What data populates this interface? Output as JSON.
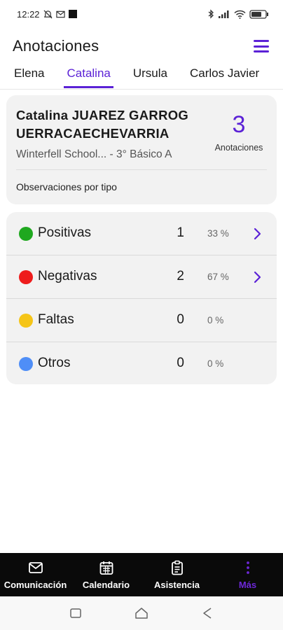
{
  "status_bar": {
    "time": "12:22",
    "icons": [
      "alarm-off-icon",
      "mail-icon",
      "square-icon",
      "bluetooth-icon",
      "signal-icon",
      "wifi-icon",
      "battery-icon"
    ]
  },
  "header": {
    "title": "Anotaciones",
    "menu_icon": "hamburger-menu-icon"
  },
  "tabs": [
    {
      "label": "Elena",
      "active": false
    },
    {
      "label": "Catalina",
      "active": true
    },
    {
      "label": "Ursula",
      "active": false
    },
    {
      "label": "Carlos Javier",
      "active": false
    }
  ],
  "student": {
    "name": "Catalina JUAREZ GARROG UERRACAECHEVARRIA",
    "school": "Winterfell School... - 3° Básico A",
    "count": "3",
    "count_label": "Anotaciones",
    "section_label": "Observaciones por tipo"
  },
  "types": [
    {
      "label": "Positivas",
      "count": "1",
      "percent": "33 %",
      "color": "#1fa81f",
      "has_chevron": true
    },
    {
      "label": "Negativas",
      "count": "2",
      "percent": "67 %",
      "color": "#ee1c1c",
      "has_chevron": true
    },
    {
      "label": "Faltas",
      "count": "0",
      "percent": "0 %",
      "color": "#f5c518",
      "has_chevron": false
    },
    {
      "label": "Otros",
      "count": "0",
      "percent": "0 %",
      "color": "#4f8ef7",
      "has_chevron": false
    }
  ],
  "bottom_nav": [
    {
      "label": "Comunicación",
      "icon": "mail-icon",
      "active": false
    },
    {
      "label": "Calendario",
      "icon": "calendar-icon",
      "active": false
    },
    {
      "label": "Asistencia",
      "icon": "clipboard-icon",
      "active": false
    },
    {
      "label": "Más",
      "icon": "more-vertical-icon",
      "active": true
    }
  ],
  "colors": {
    "accent": "#5b21d6",
    "card_bg": "#f2f2f2",
    "nav_bg": "#0a0a0a"
  }
}
